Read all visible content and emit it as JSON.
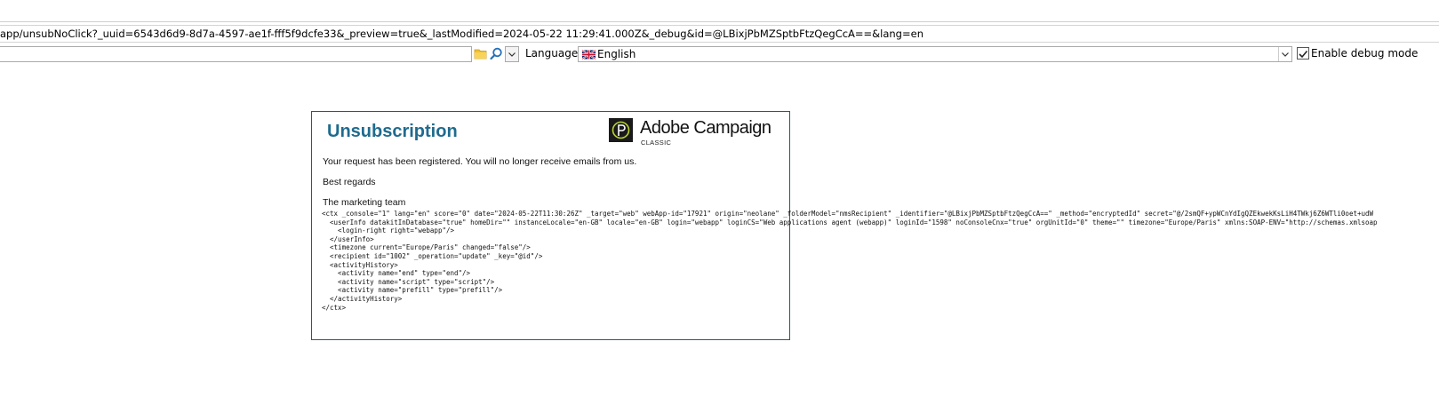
{
  "browser": {
    "url": "app/unsubNoClick?_uuid=6543d6d9-8d7a-4597-ae1f-fff5f9dcfe33&_preview=true&_lastModified=2024-05-22 11:29:41.000Z&_debug&id=@LBixjPbMZSptbFtzQegCcA==&lang=en"
  },
  "toolbar": {
    "search_value": "",
    "folder_icon": "folder-icon",
    "search_icon": "magnifier-icon",
    "language_label": "Language:",
    "language_value": "English",
    "flag_icon": "uk-flag-icon",
    "debug_checked": true,
    "debug_label": "Enable debug mode"
  },
  "page": {
    "title": "Unsubscription",
    "logo_name": "Adobe Campaign",
    "logo_sub": "CLASSIC",
    "message": "Your request has been registered. You will no longer receive emails from us.",
    "regards": "Best regards",
    "signature": "The marketing team",
    "debug_ctx": [
      "<ctx _console=\"1\" lang=\"en\" score=\"0\" date=\"2024-05-22T11:30:26Z\" _target=\"web\" webApp-id=\"17921\" origin=\"neolane\" _folderModel=\"nmsRecipient\" _identifier=\"@LBixjPbMZSptbFtzQegCcA==\" _method=\"encryptedId\" secret=\"@/2smQF+ypWCnYdIgQZEkwekKsLiH4TWkj6Z6WTli0oet+udW",
      "  <userInfo datakitInDatabase=\"true\" homeDir=\"\" instanceLocale=\"en-GB\" locale=\"en-GB\" login=\"webapp\" loginCS=\"Web applications agent (webapp)\" loginId=\"1598\" noConsoleCnx=\"true\" orgUnitId=\"0\" theme=\"\" timezone=\"Europe/Paris\" xmlns:SOAP-ENV=\"http://schemas.xmlsoap",
      "    <login-right right=\"webapp\"/>",
      "  </userInfo>",
      "  <timezone current=\"Europe/Paris\" changed=\"false\"/>",
      "  <recipient id=\"1002\" _operation=\"update\" _key=\"@id\"/>",
      "  <activityHistory>",
      "    <activity name=\"end\" type=\"end\"/>",
      "    <activity name=\"script\" type=\"script\"/>",
      "    <activity name=\"prefill\" type=\"prefill\"/>",
      "  </activityHistory>",
      "</ctx>"
    ]
  },
  "colors": {
    "title": "#1f6b8e",
    "panel_border": "#1f5b76",
    "logo_green": "#b5d335"
  }
}
